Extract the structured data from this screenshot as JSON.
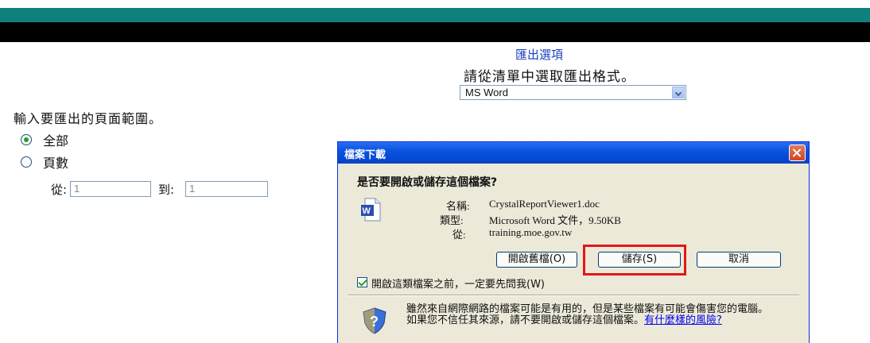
{
  "export": {
    "title": "匯出選項",
    "prompt": "請從清單中選取匯出格式。",
    "format_selected": "MS Word"
  },
  "range": {
    "label": "輸入要匯出的頁面範圍。",
    "option_all": "全部",
    "option_pages": "頁數",
    "from_label": "從:",
    "to_label": "到:",
    "from_value": "1",
    "to_value": "1",
    "selected": "全部"
  },
  "dialog": {
    "title": "檔案下載",
    "question": "是否要開啟或儲存這個檔案?",
    "name_label": "名稱:",
    "name_value": "CrystalReportViewer1.doc",
    "type_label": "類型:",
    "type_value": "Microsoft Word 文件，9.50KB",
    "from_label": "從:",
    "from_value": "training.moe.gov.tw",
    "open_button": "開啟舊檔(O)",
    "save_button": "儲存(S)",
    "cancel_button": "取消",
    "checkbox_label": "開啟這類檔案之前，一定要先問我(W)",
    "checkbox_checked": true,
    "warning_text": "雖然來自網際網路的檔案可能是有用的，但是某些檔案有可能會傷害您的電腦。如果您不信任其來源，請不要開啟或儲存這個檔案。",
    "warning_link": "有什麼樣的風險?"
  },
  "colors": {
    "teal_bar": "#10807c",
    "title_blue": "#1a3fbf",
    "highlight_red": "#e01818"
  }
}
